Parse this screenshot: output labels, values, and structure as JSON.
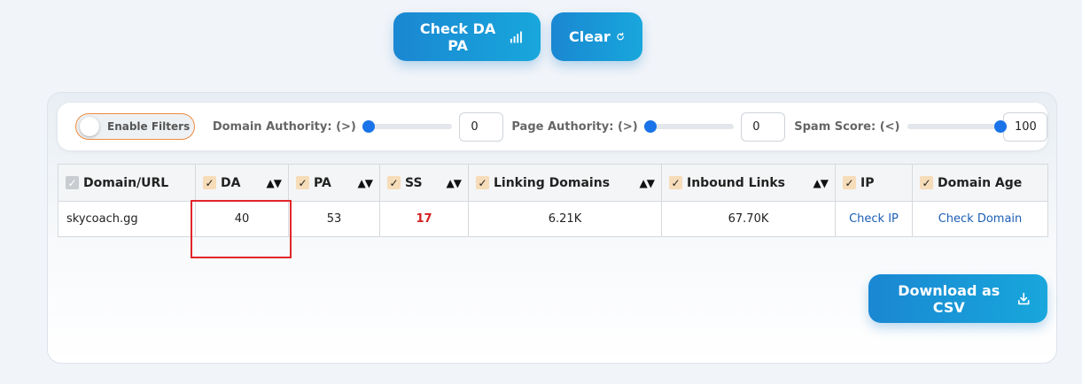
{
  "actions": {
    "check_label": "Check DA PA",
    "check_icon": "bar-chart-icon",
    "clear_label": "Clear",
    "clear_icon": "refresh-icon"
  },
  "filters": {
    "enable_label": "Enable Filters",
    "enabled": false,
    "domain_authority": {
      "label": "Domain Authority: (>)",
      "value": "0"
    },
    "page_authority": {
      "label": "Page Authority: (>)",
      "value": "0"
    },
    "spam_score": {
      "label": "Spam Score: (<)",
      "value": "100"
    }
  },
  "table": {
    "headers": {
      "domain": "Domain/URL",
      "da": "DA",
      "pa": "PA",
      "ss": "SS",
      "linking": "Linking Domains",
      "inbound": "Inbound Links",
      "ip": "IP",
      "age": "Domain Age"
    },
    "sort_glyph": "▲▼",
    "check_glyph": "✓",
    "rows": [
      {
        "domain": "skycoach.gg",
        "da": "40",
        "pa": "53",
        "ss": "17",
        "linking": "6.21K",
        "inbound": "67.70K",
        "ip": "Check IP",
        "age": "Check Domain"
      }
    ]
  },
  "download": {
    "label": "Download as CSV",
    "icon": "download-icon"
  },
  "colors": {
    "accent": "#1a87d2",
    "toggle_border": "#f08a3c",
    "spam_score": "#d51f1f",
    "link": "#1d5fb5",
    "highlight": "#e0262b"
  }
}
